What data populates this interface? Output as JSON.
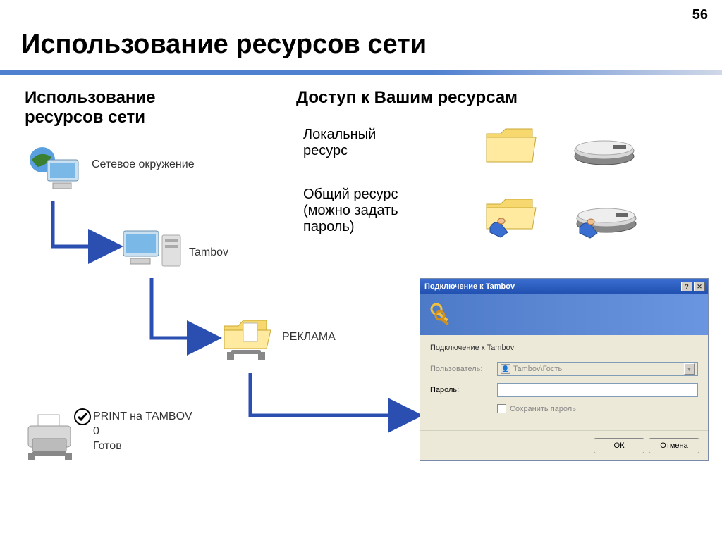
{
  "page_number": "56",
  "title": "Использование ресурсов сети",
  "subtitle_left": "Использование ресурсов сети",
  "subtitle_right": "Доступ к Вашим ресурсам",
  "local_resource": "Локальный ресурс",
  "shared_resource": "Общий ресурс (можно задать пароль)",
  "diagram": {
    "network_neighborhood": "Сетевое окружение",
    "computer": "Tambov",
    "share": "РЕКЛАМА",
    "printer_name": "PRINT на TAMBOV",
    "printer_jobs": "0",
    "printer_status": "Готов"
  },
  "dialog": {
    "title": "Подключение к Tambov",
    "subtitle": "Подключение к Tambov",
    "user_label": "Пользователь:",
    "user_value": "Tambov\\Гость",
    "password_label": "Пароль:",
    "save_password": "Сохранить пароль",
    "ok": "ОК",
    "cancel": "Отмена"
  }
}
